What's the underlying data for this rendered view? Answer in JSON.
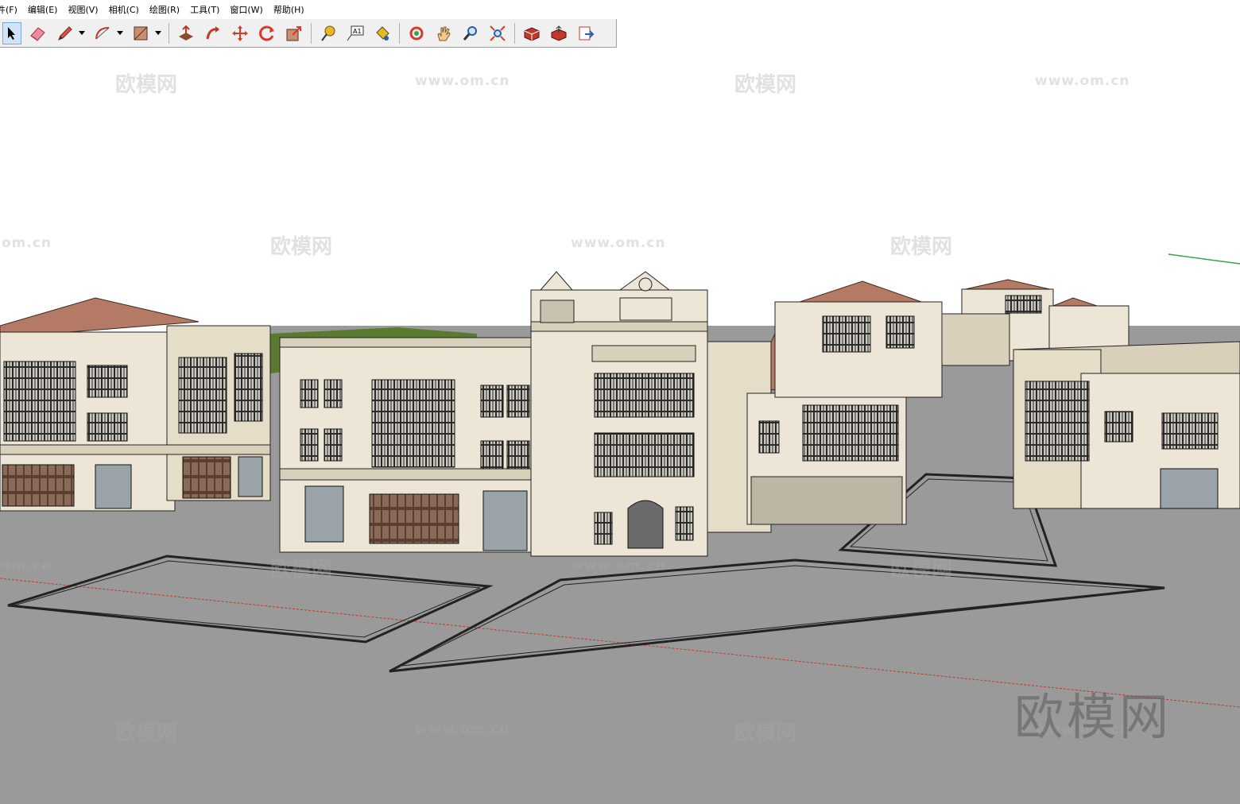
{
  "menu": {
    "items": [
      "件(F)",
      "编辑(E)",
      "视图(V)",
      "相机(C)",
      "绘图(R)",
      "工具(T)",
      "窗口(W)",
      "帮助(H)"
    ]
  },
  "toolbar": {
    "tools": [
      {
        "name": "select-tool-icon",
        "color": "#000000",
        "active": true
      },
      {
        "name": "eraser-tool-icon",
        "color": "#e85a7a"
      },
      {
        "name": "pencil-line-tool-icon",
        "color": "#c0392b",
        "dropdown": true
      },
      {
        "name": "arc-tool-icon",
        "color": "#c0392b",
        "dropdown": true
      },
      {
        "name": "rectangle-tool-icon",
        "color": "#a0522d",
        "dropdown": true
      },
      {
        "name": "push-pull-tool-icon",
        "color": "#c0392b"
      },
      {
        "name": "follow-me-tool-icon",
        "color": "#c0392b"
      },
      {
        "name": "move-tool-icon",
        "color": "#c0392b"
      },
      {
        "name": "rotate-tool-icon",
        "color": "#c0392b"
      },
      {
        "name": "scale-tool-icon",
        "color": "#c0392b"
      },
      {
        "name": "tape-measure-tool-icon",
        "color": "#d4a017"
      },
      {
        "name": "text-tool-icon",
        "color": "#333333"
      },
      {
        "name": "paint-bucket-tool-icon",
        "color": "#d4a017"
      },
      {
        "name": "orbit-tool-icon",
        "color": "#c0392b"
      },
      {
        "name": "pan-tool-icon",
        "color": "#e0b070"
      },
      {
        "name": "zoom-tool-icon",
        "color": "#2a5db0"
      },
      {
        "name": "zoom-extents-tool-icon",
        "color": "#c0392b"
      },
      {
        "name": "warehouse-get-models-icon",
        "color": "#c0392b"
      },
      {
        "name": "warehouse-share-model-icon",
        "color": "#c0392b"
      },
      {
        "name": "extension-warehouse-icon",
        "color": "#c0392b"
      }
    ],
    "text_tool_glyph": "A1"
  },
  "viewport": {
    "sky_color": "#ffffff",
    "ground_color": "#9a9a9a",
    "roof_color": "#b57a66",
    "wall_color": "#ede6d6",
    "axis_red": "#c0392b",
    "axis_green": "#2fa84f"
  },
  "watermarks": {
    "brand": "欧模网",
    "url": "www.om.cn",
    "url_short": "om.cn",
    "big": "欧模网"
  }
}
